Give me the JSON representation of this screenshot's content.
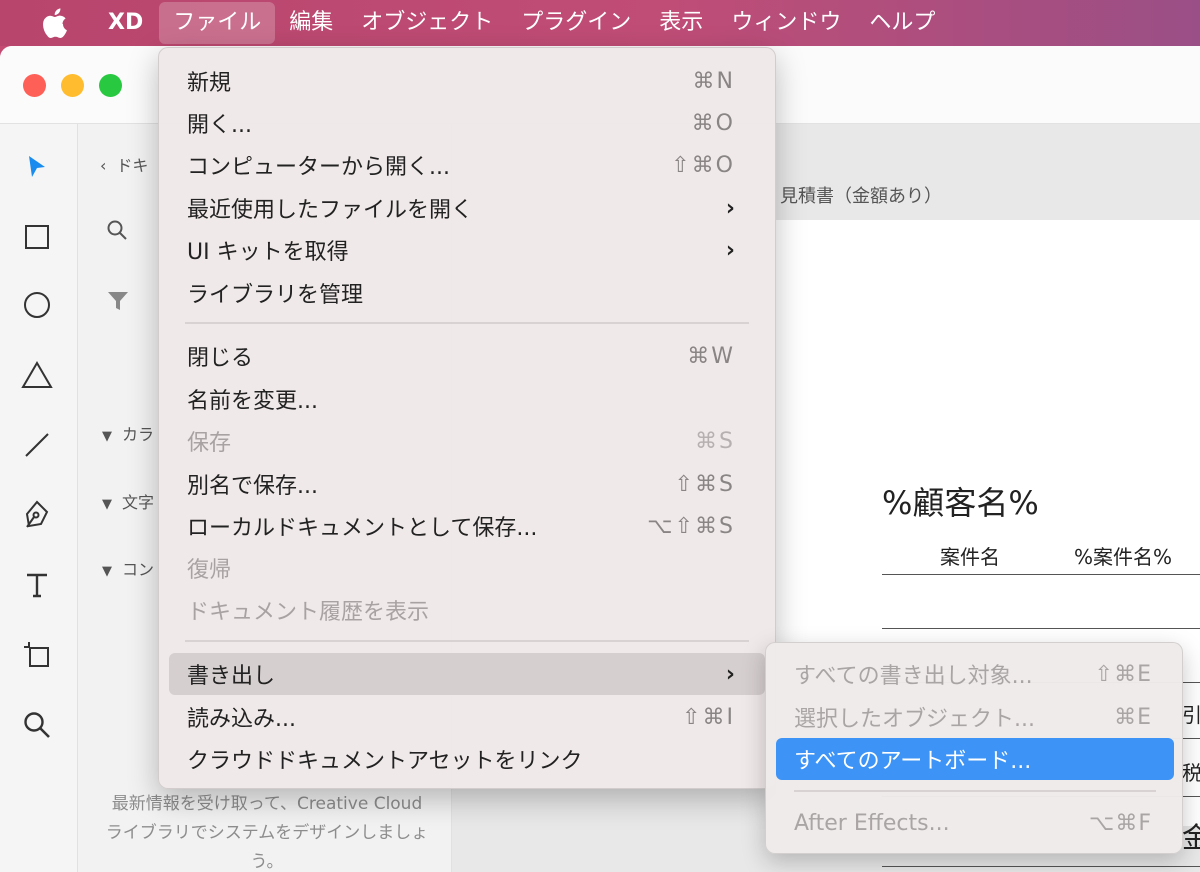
{
  "menubar": {
    "app": "XD",
    "items": [
      "ファイル",
      "編集",
      "オブジェクト",
      "プラグイン",
      "表示",
      "ウィンドウ",
      "ヘルプ"
    ]
  },
  "panel": {
    "crumb": "ドキ",
    "sections": [
      "カラ",
      "文字",
      "コン"
    ],
    "note": "最新情報を受け取って、Creative Cloud ライブラリでシステムをデザインしましょう。"
  },
  "canvas": {
    "artboard_label": "見積書（金額あり）",
    "doc_title": "%顧客名%",
    "row_label": "案件名",
    "row_value": "%案件名%",
    "edge_fragments": [
      "引%",
      "税%",
      "金"
    ]
  },
  "file_menu": {
    "items": [
      {
        "label": "新規",
        "shortcut": "⌘N",
        "disabled": false,
        "submenu": false
      },
      {
        "label": "開く...",
        "shortcut": "⌘O",
        "disabled": false,
        "submenu": false
      },
      {
        "label": "コンピューターから開く...",
        "shortcut": "⇧⌘O",
        "disabled": false,
        "submenu": false
      },
      {
        "label": "最近使用したファイルを開く",
        "shortcut": "",
        "disabled": false,
        "submenu": true
      },
      {
        "label": "UI キットを取得",
        "shortcut": "",
        "disabled": false,
        "submenu": true
      },
      {
        "label": "ライブラリを管理",
        "shortcut": "",
        "disabled": false,
        "submenu": false
      },
      {
        "label": "閉じる",
        "shortcut": "⌘W",
        "disabled": false,
        "submenu": false
      },
      {
        "label": "名前を変更...",
        "shortcut": "",
        "disabled": false,
        "submenu": false
      },
      {
        "label": "保存",
        "shortcut": "⌘S",
        "disabled": true,
        "submenu": false
      },
      {
        "label": "別名で保存...",
        "shortcut": "⇧⌘S",
        "disabled": false,
        "submenu": false
      },
      {
        "label": "ローカルドキュメントとして保存...",
        "shortcut": "⌥⇧⌘S",
        "disabled": false,
        "submenu": false
      },
      {
        "label": "復帰",
        "shortcut": "",
        "disabled": true,
        "submenu": false
      },
      {
        "label": "ドキュメント履歴を表示",
        "shortcut": "",
        "disabled": true,
        "submenu": false
      },
      {
        "label": "書き出し",
        "shortcut": "",
        "disabled": false,
        "submenu": true,
        "highlighted": true
      },
      {
        "label": "読み込み...",
        "shortcut": "⇧⌘I",
        "disabled": false,
        "submenu": false
      },
      {
        "label": "クラウドドキュメントアセットをリンク",
        "shortcut": "",
        "disabled": false,
        "submenu": false
      }
    ]
  },
  "export_submenu": {
    "items": [
      {
        "label": "すべての書き出し対象...",
        "shortcut": "⇧⌘E",
        "disabled": true
      },
      {
        "label": "選択したオブジェクト...",
        "shortcut": "⌘E",
        "disabled": true
      },
      {
        "label": "すべてのアートボード...",
        "shortcut": "",
        "disabled": false,
        "selected": true
      },
      {
        "label": "After Effects...",
        "shortcut": "⌥⌘F",
        "disabled": true
      }
    ]
  },
  "colors": {
    "menubar": "#c04d76",
    "selection": "#3d94f6",
    "tool_active": "#1a8cf0"
  }
}
